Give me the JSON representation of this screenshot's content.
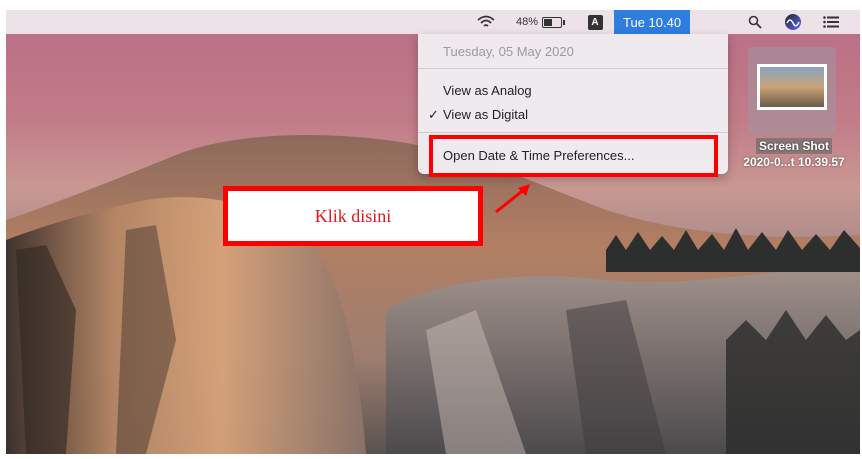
{
  "menubar": {
    "battery_percent": "48%",
    "input_source_label": "A",
    "clock": "Tue 10.40",
    "icons": [
      "wifi-icon",
      "battery-icon",
      "input-source-icon",
      "spotlight-icon",
      "siri-icon",
      "notification-center-icon"
    ]
  },
  "clock_menu": {
    "date": "Tuesday, 05 May 2020",
    "items": [
      {
        "label": "View as Analog",
        "checked": false
      },
      {
        "label": "View as Digital",
        "checked": true
      }
    ],
    "check_mark": "✓",
    "preferences_label": "Open Date & Time Preferences..."
  },
  "desktop_file": {
    "label_line1": "Screen Shot",
    "label_line2": "2020-0...t 10.39.57"
  },
  "annotation": {
    "callout_text": "Klik disini",
    "highlight_color": "#ff0000"
  }
}
